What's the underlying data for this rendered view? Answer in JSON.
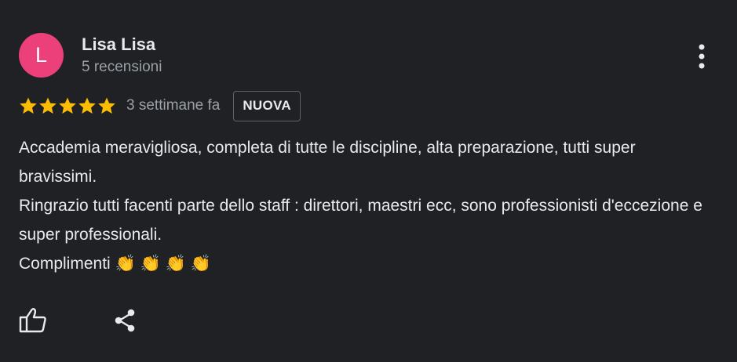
{
  "review": {
    "avatar_letter": "L",
    "avatar_color": "#ec407a",
    "author_name": "Lisa Lisa",
    "author_reviews": "5 recensioni",
    "rating": 5,
    "max_rating": 5,
    "date": "3 settimane fa",
    "badge": "NUOVA",
    "text_lines": [
      "Accademia meravigliosa, completa di tutte le discipline, alta preparazione, tutti super bravissimi.",
      "Ringrazio tutti facenti parte dello staff : direttori, maestri ecc, sono professionisti d'eccezione e super professionali.",
      "Complimenti 👏 👏 👏 👏"
    ]
  },
  "icons": {
    "menu": "more-vert-icon",
    "like": "thumb-up-icon",
    "share": "share-icon",
    "star": "star-icon"
  },
  "colors": {
    "background": "#202124",
    "star": "#fbbc04",
    "text_primary": "#e8eaed",
    "text_secondary": "#9aa0a6"
  }
}
